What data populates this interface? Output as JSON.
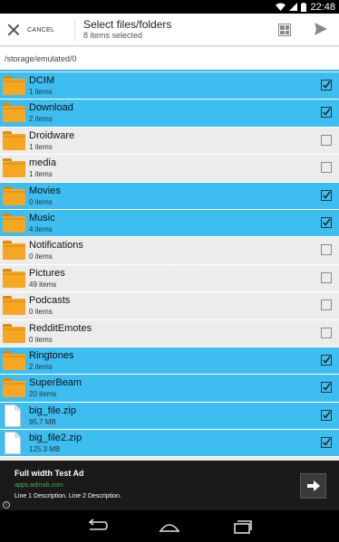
{
  "status_bar": {
    "time": "22:48"
  },
  "header": {
    "cancel_label": "CANCEL",
    "title": "Select files/folders",
    "subtitle": "8 items selected"
  },
  "path": "/storage/emulated/0",
  "items": [
    {
      "name": "DCIM",
      "detail": "1 items",
      "type": "folder",
      "selected": true
    },
    {
      "name": "Download",
      "detail": "2 items",
      "type": "folder",
      "selected": true
    },
    {
      "name": "Droidware",
      "detail": "1 items",
      "type": "folder",
      "selected": false
    },
    {
      "name": "media",
      "detail": "1 items",
      "type": "folder",
      "selected": false
    },
    {
      "name": "Movies",
      "detail": "0 items",
      "type": "folder",
      "selected": true
    },
    {
      "name": "Music",
      "detail": "4 items",
      "type": "folder",
      "selected": true
    },
    {
      "name": "Notifications",
      "detail": "0 items",
      "type": "folder",
      "selected": false
    },
    {
      "name": "Pictures",
      "detail": "49 items",
      "type": "folder",
      "selected": false
    },
    {
      "name": "Podcasts",
      "detail": "0 items",
      "type": "folder",
      "selected": false
    },
    {
      "name": "RedditEmotes",
      "detail": "0 items",
      "type": "folder",
      "selected": false
    },
    {
      "name": "Ringtones",
      "detail": "2 items",
      "type": "folder",
      "selected": true
    },
    {
      "name": "SuperBeam",
      "detail": "20 items",
      "type": "folder",
      "selected": true
    },
    {
      "name": "big_file.zip",
      "detail": "95.7 MB",
      "type": "file",
      "selected": true
    },
    {
      "name": "big_file2.zip",
      "detail": "125.3 MB",
      "type": "file",
      "selected": true
    }
  ],
  "ad": {
    "headline": "Full width Test Ad",
    "url": "apps.admob.com",
    "description": "Line 1 Description. Line 2 Description."
  },
  "colors": {
    "selected_row": "#3dbdf0",
    "accent": "#33b5e5",
    "folder": "#f5a623"
  },
  "icons": {
    "cancel": "close-icon",
    "grid": "grid-view-icon",
    "send": "send-icon",
    "folder": "folder-icon",
    "file": "file-icon",
    "check": "checkmark-icon"
  }
}
